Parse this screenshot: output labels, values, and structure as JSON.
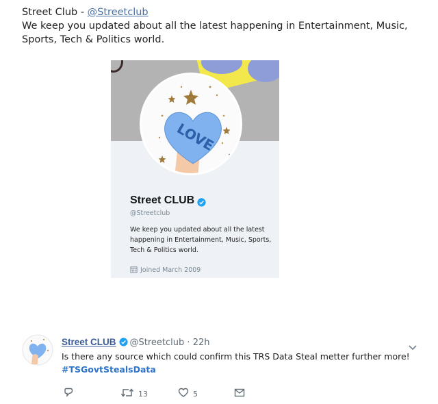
{
  "header": {
    "name": "Street Club",
    "separator": " - ",
    "handle": "@Streetclub",
    "bio": "We keep you updated about all the latest happening in Entertainment, Music, Sports, Tech & Politics world."
  },
  "profile_card": {
    "name": "Street CLUB",
    "handle": "@Streetclub",
    "bio": "We keep you updated about all the latest happening in Entertainment, Music, Sports, Tech & Politics world.",
    "joined": "Joined March 2009",
    "avatar_text": "LOVE",
    "colors": {
      "banner": "#b3b3b3",
      "banner_yellow": "#f2e84b",
      "heart": "#7fb2ee",
      "verified": "#1da1f2"
    }
  },
  "tweet": {
    "name": "Street CLUB",
    "handle": "@Streetclub",
    "separator": " · ",
    "time": "22h",
    "text": "Is there any source which could confirm this TRS Data Steal metter further more!",
    "hashtag": "#TSGovtStealsData",
    "actions": {
      "reply_count": "",
      "retweet_count": "13",
      "like_count": "5"
    },
    "icons": [
      "reply-icon",
      "retweet-icon",
      "like-icon",
      "message-icon",
      "chevron-down-icon"
    ]
  }
}
